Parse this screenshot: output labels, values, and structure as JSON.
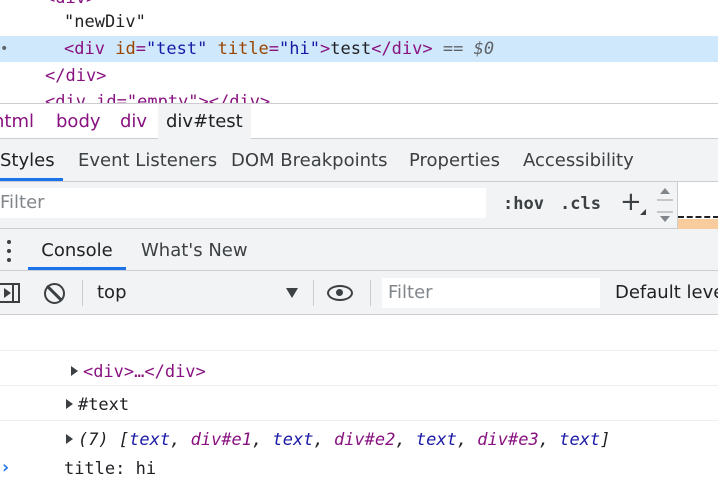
{
  "elements_tree": {
    "line_top_partial": "<div>",
    "text_node": "\"newDiv\"",
    "selected": {
      "open": "<div",
      "attr1_name": "id",
      "attr1_value": "\"test\"",
      "attr2_name": "title",
      "attr2_value": "\"hi\"",
      "gt": ">",
      "content": "test",
      "close": "</div>",
      "marker": "== $0"
    },
    "close_div": "</div>",
    "partial_next": "<div id=\"empty\"></div>"
  },
  "breadcrumbs": [
    "html",
    "body",
    "div",
    "div#test"
  ],
  "sidebar_tabs": [
    "Styles",
    "Event Listeners",
    "DOM Breakpoints",
    "Properties",
    "Accessibility"
  ],
  "styles_filter": {
    "placeholder": "Filter",
    "hov": ":hov",
    "cls": ".cls",
    "add": "+"
  },
  "drawer_tabs": [
    "Console",
    "What's New"
  ],
  "console_toolbar": {
    "context": "top",
    "filter_placeholder": "Filter",
    "levels": "Default levels"
  },
  "console_messages": [
    {
      "kind": "element",
      "text": "<div>…</div>"
    },
    {
      "kind": "node",
      "text": "#text"
    },
    {
      "kind": "array",
      "count": "(7)",
      "items": [
        "text",
        "div#e1",
        "text",
        "div#e2",
        "text",
        "div#e3",
        "text"
      ]
    },
    {
      "kind": "log",
      "text": "title: hi"
    }
  ],
  "prompt": "›",
  "colors": {
    "tag": "#881280",
    "attr_name": "#994500",
    "attr_value": "#1a1aa6",
    "selection": "#cfe8fc",
    "accent": "#1a73e8"
  }
}
